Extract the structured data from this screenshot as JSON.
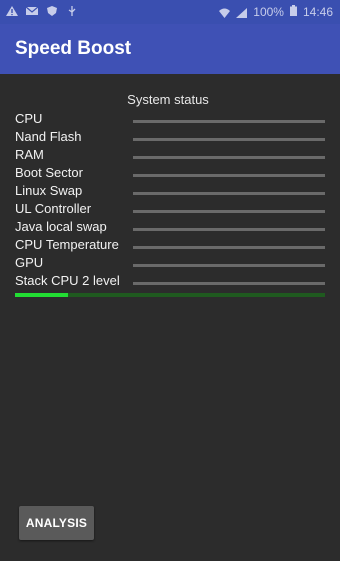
{
  "status_bar": {
    "battery": "100%",
    "time": "14:46",
    "icons": [
      "warning-icon",
      "mail-icon",
      "shield-icon",
      "usb-icon",
      "wifi-icon",
      "signal-icon",
      "battery-icon"
    ]
  },
  "app_bar": {
    "title": "Speed Boost"
  },
  "colors": {
    "app_bar": "#3f51b5",
    "status_bar": "#3a4fb0",
    "background": "#2c2c2c",
    "progress_green": "#22dd33"
  },
  "main": {
    "section_title": "System status",
    "items": [
      {
        "label": "CPU",
        "progress": 0
      },
      {
        "label": "Nand Flash",
        "progress": 0
      },
      {
        "label": "RAM",
        "progress": 0
      },
      {
        "label": "Boot Sector",
        "progress": 0
      },
      {
        "label": "Linux Swap",
        "progress": 0
      },
      {
        "label": "UL Controller",
        "progress": 0
      },
      {
        "label": "Java local swap",
        "progress": 0
      },
      {
        "label": "CPU Temperature",
        "progress": 0
      },
      {
        "label": "GPU",
        "progress": 0
      },
      {
        "label": "Stack CPU 2 level",
        "progress": 0
      }
    ],
    "overall_progress": 0.17
  },
  "actions": {
    "analysis_label": "ANALYSIS"
  }
}
